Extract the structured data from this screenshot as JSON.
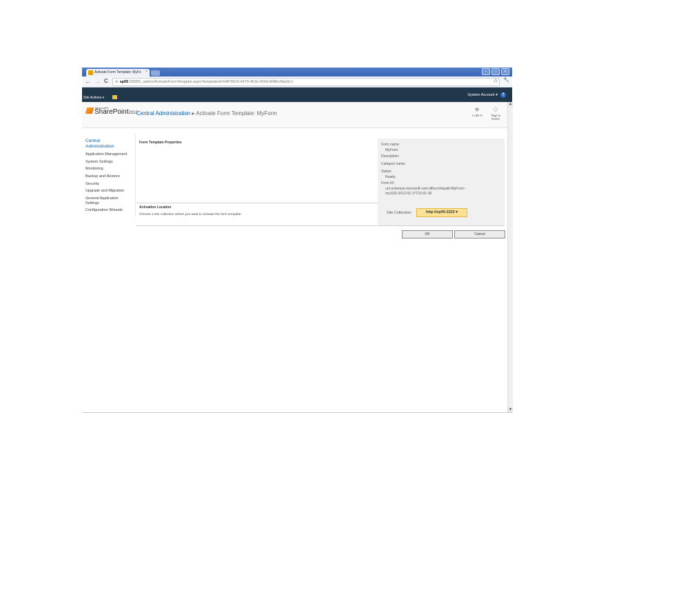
{
  "browser": {
    "tab_title": "Activate Form Template: MyFo",
    "tab_close": "×",
    "window_buttons": [
      "–",
      "□",
      "✕"
    ],
    "nav": {
      "back": "←",
      "forward": "→",
      "reload": "C"
    },
    "url_icon": "⊘",
    "url_host": "sp05",
    "url_path": ":28085/_admin/ActivateFormTemplate.aspx?templateId=54f79510-4579-461b-920d-808bc9fad3c1",
    "star": "☆",
    "wrench": "🔧"
  },
  "ribbon": {
    "site_actions": "Site Actions ▾",
    "system_account": "System Account ▾"
  },
  "header": {
    "logo_ms": "Microsoft®",
    "logo_sp": "SharePoint",
    "logo_year": "2010",
    "breadcrumb_root": "Central Administration",
    "breadcrumb_sep": "▸",
    "breadcrumb_page": "Activate Form Template: MyForm",
    "i_like_it": "I Like It",
    "tags_notes_1": "Tags &",
    "tags_notes_2": "Notes",
    "help": "?"
  },
  "leftnav": {
    "heading_1": "Central",
    "heading_2": "Administration",
    "items": [
      "Application Management",
      "System Settings",
      "Monitoring",
      "Backup and Restore",
      "Security",
      "Upgrade and Migration",
      "General Application",
      "Settings",
      "Configuration Wizards"
    ]
  },
  "form_props": {
    "title": "Form Template Properties",
    "form_name_label": "Form name:",
    "form_name": "MyForm",
    "description_label": "Description:",
    "category_label": "Category name:",
    "status_label": "Status:",
    "status": "Ready",
    "form_id_label": "Form ID:",
    "form_id_1": "urn:schemas-microsoft-com:office:infopath:MyForm:-",
    "form_id_2": "myXSD-2012-02-17T23-01-36"
  },
  "activation": {
    "title": "Activation Location",
    "description": "Choose a site collection where you want to activate the form template.",
    "site_collection_label": "Site Collection:",
    "site_collection_value": "http://sp05:2222 ▾"
  },
  "buttons": {
    "ok": "OK",
    "cancel": "Cancel"
  },
  "scroll": {
    "up": "▲",
    "down": "▼"
  },
  "colors": {
    "title_bar": "#3a66b8",
    "ribbon": "#21374c",
    "link": "#0a5ca8",
    "picker": "#fbe192"
  }
}
